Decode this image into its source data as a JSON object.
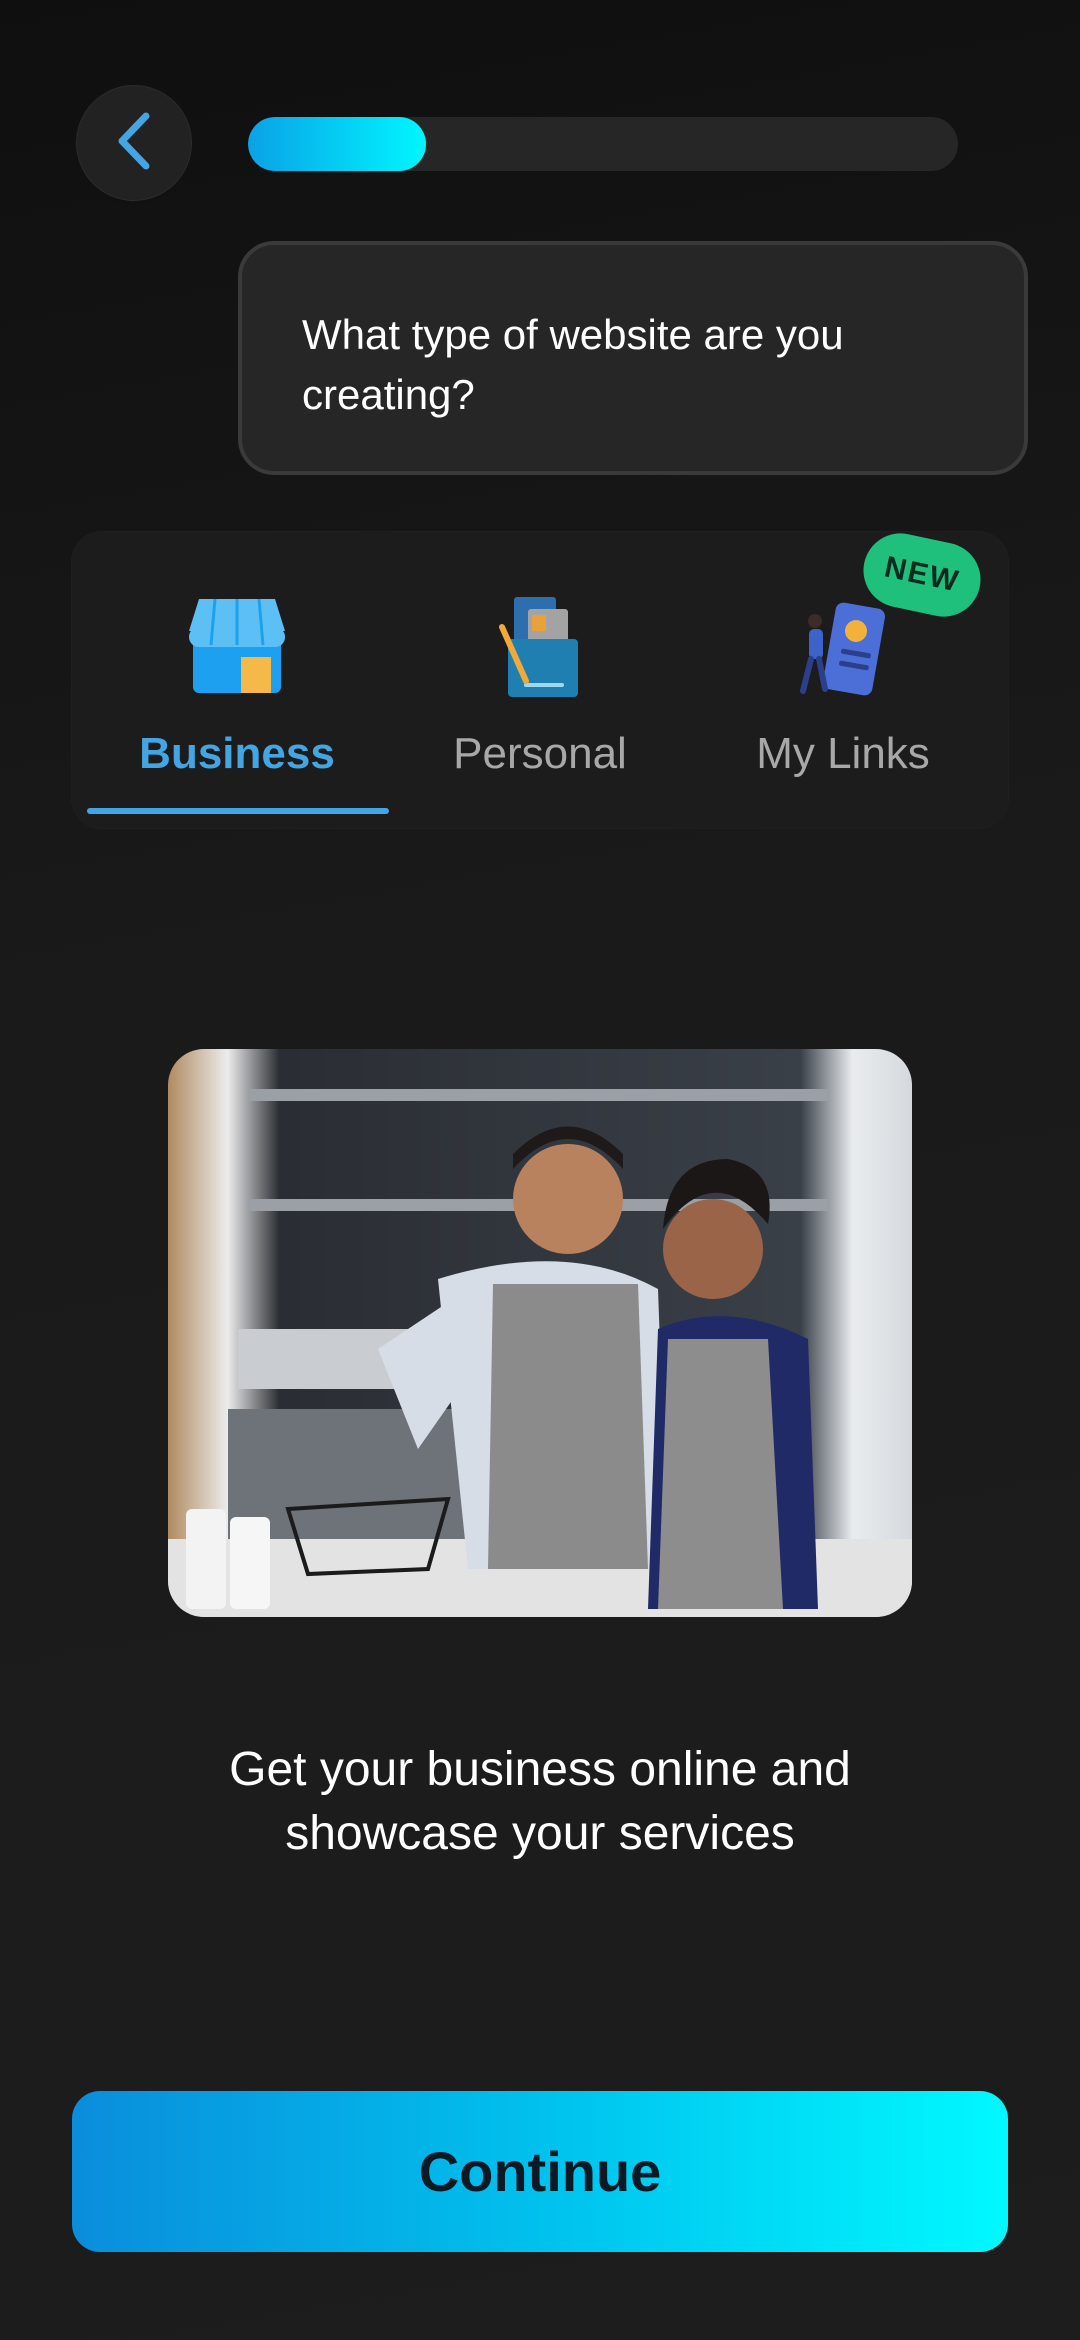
{
  "header": {
    "back_icon": "chevron-left-icon",
    "progress": 0.25
  },
  "prompt": {
    "question": "What type of website are you creating?"
  },
  "tabs": [
    {
      "label": "Business",
      "icon": "storefront-icon",
      "active": true
    },
    {
      "label": "Personal",
      "icon": "portfolio-icon",
      "active": false
    },
    {
      "label": "My Links",
      "icon": "link-in-bio-icon",
      "active": false,
      "badge": "NEW"
    }
  ],
  "main": {
    "image": "business-owners-photo",
    "description": "Get your business online and showcase your services"
  },
  "footer": {
    "continue_label": "Continue"
  },
  "colors": {
    "accent": "#43a6e3",
    "badge": "#1fbf7c",
    "gradient_start": "#0a8ddb",
    "gradient_end": "#00f9ff"
  }
}
